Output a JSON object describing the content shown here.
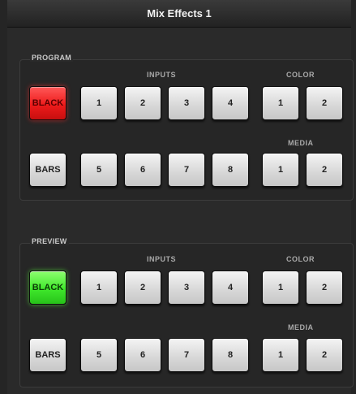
{
  "window": {
    "title": "Mix Effects 1"
  },
  "program": {
    "section_label": "PROGRAM",
    "inputs_label": "INPUTS",
    "color_label": "COLOR",
    "media_label": "MEDIA",
    "row1": {
      "source": "BLACK",
      "inputs": [
        "1",
        "2",
        "3",
        "4"
      ],
      "color": [
        "1",
        "2"
      ]
    },
    "row2": {
      "source": "BARS",
      "inputs": [
        "5",
        "6",
        "7",
        "8"
      ],
      "media": [
        "1",
        "2"
      ]
    },
    "active": "BLACK",
    "active_color": "#ee1b1b"
  },
  "preview": {
    "section_label": "PREVIEW",
    "inputs_label": "INPUTS",
    "color_label": "COLOR",
    "media_label": "MEDIA",
    "row1": {
      "source": "BLACK",
      "inputs": [
        "1",
        "2",
        "3",
        "4"
      ],
      "color": [
        "1",
        "2"
      ]
    },
    "row2": {
      "source": "BARS",
      "inputs": [
        "5",
        "6",
        "7",
        "8"
      ],
      "media": [
        "1",
        "2"
      ]
    },
    "active": "BLACK",
    "active_color": "#3fe82b"
  }
}
